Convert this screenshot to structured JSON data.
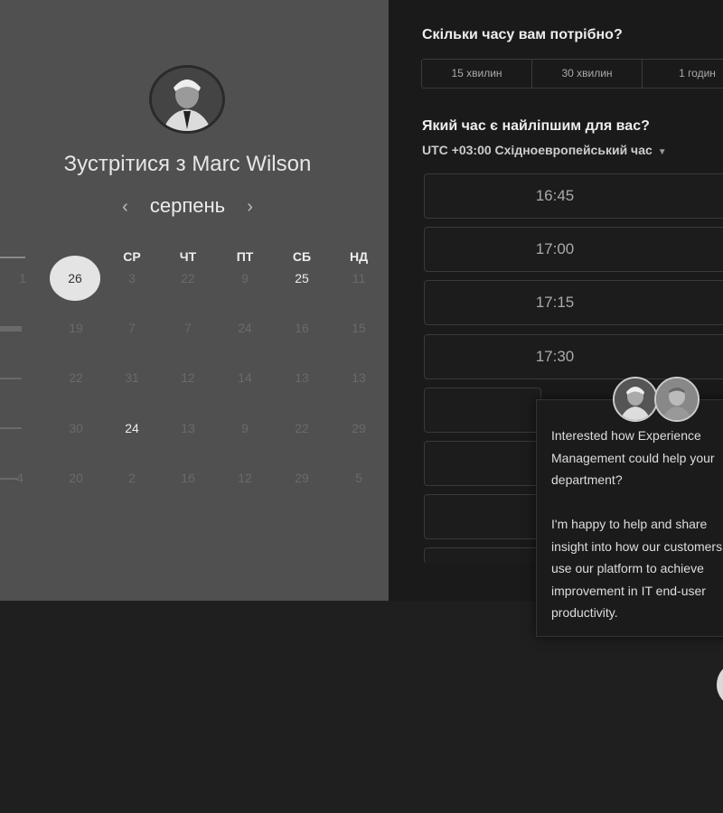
{
  "host": {
    "title_prefix": "Зустрітися з",
    "name": "Marc Wilson"
  },
  "calendar": {
    "month": "серпень",
    "prev_icon": "chevron-left-icon",
    "next_icon": "chevron-right-icon",
    "weekdays": [
      "СР",
      "ЧТ",
      "ПТ",
      "СБ",
      "НД"
    ],
    "selected_day": "26",
    "rows": [
      [
        "1",
        "3",
        "22",
        "9",
        "25",
        "11"
      ],
      [
        "19",
        "7",
        "7",
        "24",
        "16",
        "15"
      ],
      [
        "22",
        "31",
        "12",
        "14",
        "13",
        "13"
      ],
      [
        "30",
        "24",
        "13",
        "9",
        "22",
        "29"
      ],
      [
        "4",
        "20",
        "2",
        "16",
        "12",
        "29",
        "5"
      ]
    ]
  },
  "duration": {
    "question": "Скільки часу вам потрібно?",
    "options": [
      "15 хвилин",
      "30 хвилин",
      "1 годин"
    ]
  },
  "time": {
    "question": "Який час є найліпшим для вас?",
    "timezone": "UTC +03:00 Східноевропейський час",
    "slots": [
      "16:45",
      "17:00",
      "17:15",
      "17:30"
    ]
  },
  "chat": {
    "message": "Interested how Experience\nManagement could help your\ndepartment?\n\nI'm happy to help and share\ninsight into how our customers\nuse our platform to achieve\nimprovement in IT end-user\nproductivity."
  },
  "colors": {
    "left_panel": "#505050",
    "right_panel": "#1a1a1a",
    "selected_day_bg": "#e4e4e4"
  }
}
